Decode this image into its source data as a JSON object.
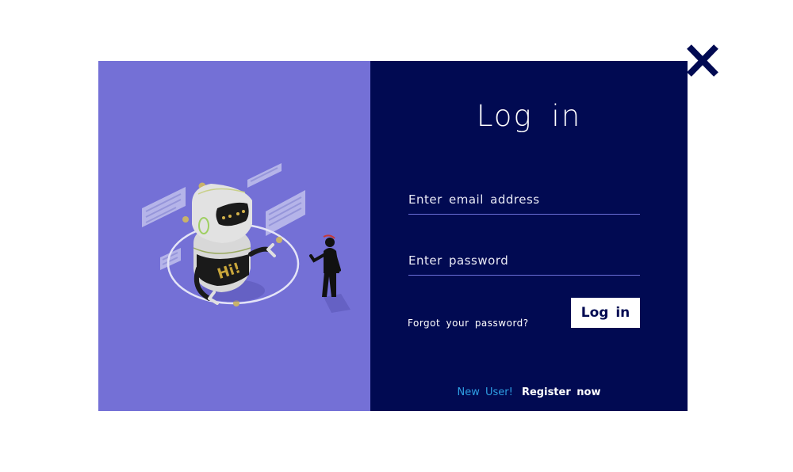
{
  "login": {
    "title": "Log in",
    "email_placeholder": "Enter email address",
    "password_placeholder": "Enter password",
    "forgot_link": "Forgot your password?",
    "login_button": "Log in",
    "new_user_text": "New User!",
    "register_link": "Register now"
  },
  "illustration": {
    "robot_chest_text": "Hi!"
  },
  "icons": {
    "close": "close-icon"
  },
  "colors": {
    "left_panel": "#7470d6",
    "right_panel": "#010a52",
    "accent_link": "#2f9fe3",
    "close_icon": "#010a52"
  }
}
